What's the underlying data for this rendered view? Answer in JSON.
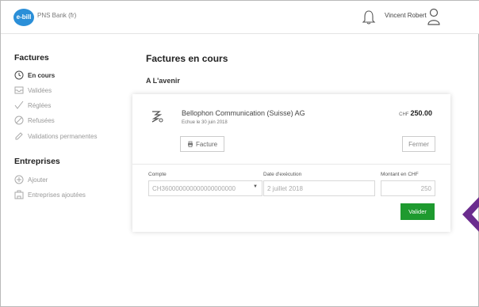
{
  "header": {
    "logo_text": "e-bill",
    "bank_name": "PNS Bank (fr)",
    "user_name": "Vincent Robert",
    "bell_icon": "bell-icon",
    "user_icon": "user-icon"
  },
  "sidebar": {
    "factures_title": "Factures",
    "factures_items": [
      {
        "label": "En cours",
        "icon": "clock-icon",
        "active": true
      },
      {
        "label": "Validées",
        "icon": "tray-icon",
        "active": false
      },
      {
        "label": "Réglées",
        "icon": "check-icon",
        "active": false
      },
      {
        "label": "Refusées",
        "icon": "block-icon",
        "active": false
      },
      {
        "label": "Validations permanentes",
        "icon": "pencil-icon",
        "active": false
      }
    ],
    "entreprises_title": "Entreprises",
    "entreprises_items": [
      {
        "label": "Ajouter",
        "icon": "plus-circle-icon"
      },
      {
        "label": "Entreprises ajoutées",
        "icon": "building-icon"
      }
    ]
  },
  "main": {
    "page_title": "Factures en cours",
    "section_title": "A L'avenir",
    "card": {
      "company": "Bellophon Communication (Suisse) AG",
      "due": "Echue le 30 juin 2018",
      "currency": "CHF",
      "amount": "250.00",
      "facture_button": "Facture",
      "fermer_button": "Fermer",
      "compte_label": "Compte",
      "compte_value": "CH360000000000000000000",
      "date_label": "Date d'exécution",
      "date_value": "2 juillet 2018",
      "montant_label": "Montant en CHF",
      "montant_value": "250",
      "valider_button": "Valider"
    }
  },
  "colors": {
    "accent_green": "#1e9a2f",
    "logo_blue": "#2b8fd8",
    "arrow_purple": "#6b2c8e"
  }
}
